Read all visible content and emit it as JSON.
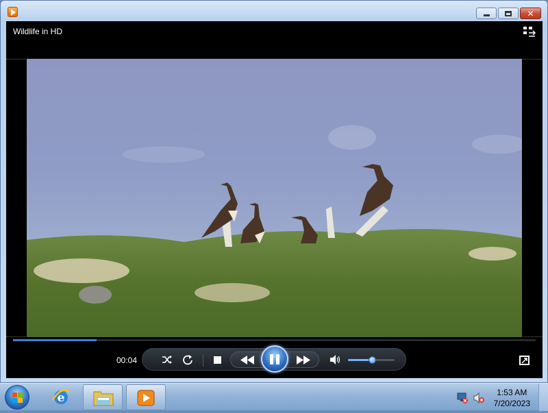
{
  "window": {
    "title": "",
    "controls": [
      "minimize-icon",
      "maximize-icon",
      "close-icon"
    ]
  },
  "player": {
    "video_title": "Wildlife in HD",
    "elapsed_time": "00:04",
    "seek_progress": 0.16,
    "volume_level": 0.52,
    "state": "playing"
  },
  "taskbar": {
    "pinned": [
      "start-orb",
      "internet-explorer-icon",
      "windows-explorer-icon",
      "windows-media-player-icon"
    ],
    "clock_time": "1:53 AM",
    "clock_date": "7/20/2023",
    "tray_icons": [
      "network-icon",
      "speaker-muted-icon"
    ]
  },
  "colors": {
    "accent": "#3b7fd6",
    "player_bg": "#000000",
    "taskbar": "#93b3d8"
  }
}
